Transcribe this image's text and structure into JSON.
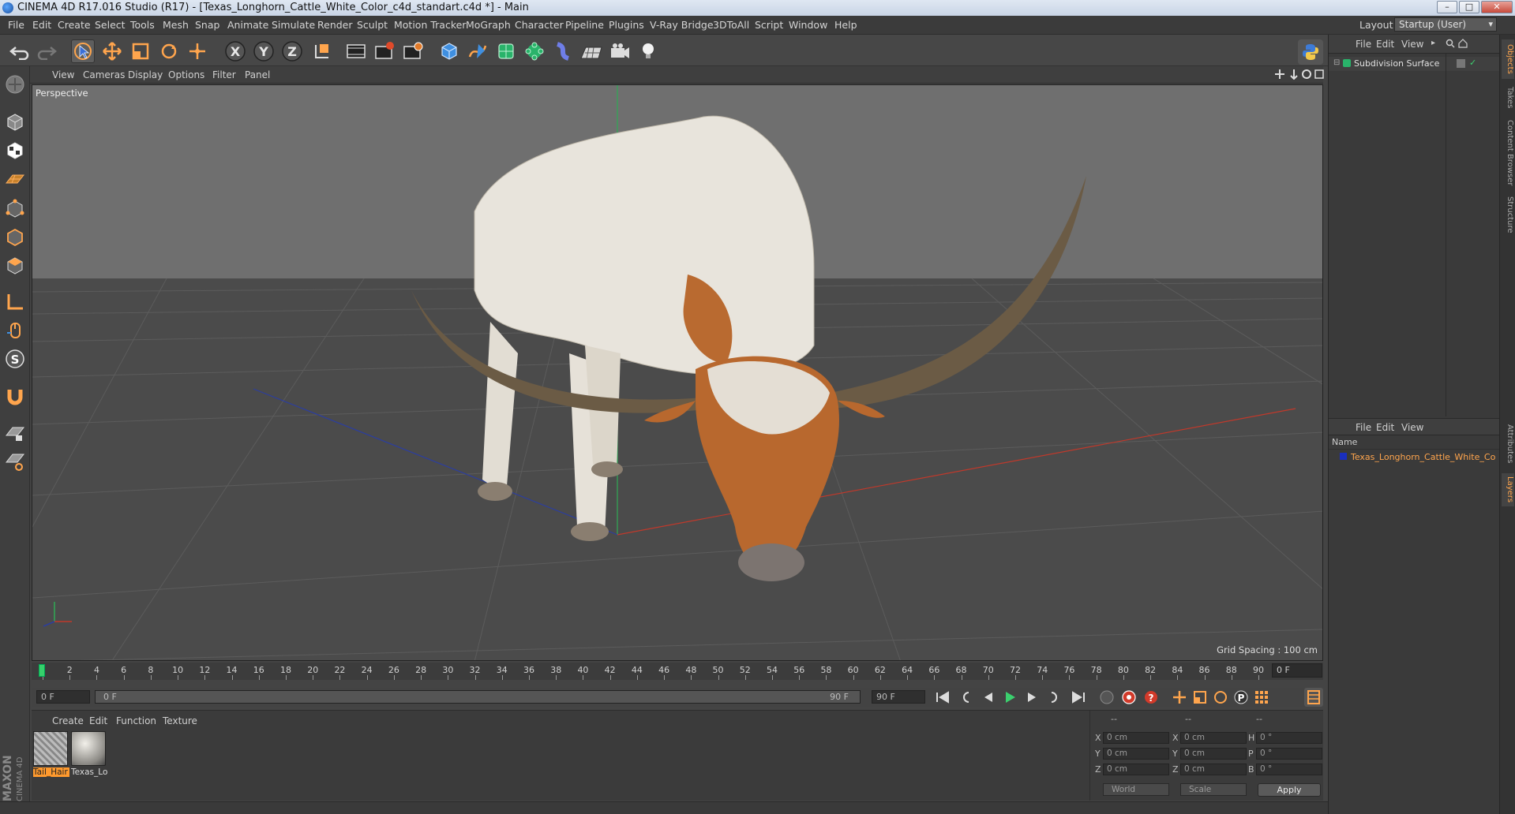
{
  "window": {
    "title": "CINEMA 4D R17.016 Studio (R17) - [Texas_Longhorn_Cattle_White_Color_c4d_standart.c4d *] - Main",
    "buttons": {
      "minimize": "–",
      "maximize": "□",
      "close": "✕"
    }
  },
  "menubar": {
    "items": [
      "File",
      "Edit",
      "Create",
      "Select",
      "Tools",
      "Mesh",
      "Snap",
      "Animate",
      "Simulate",
      "Render",
      "Sculpt",
      "Motion Tracker",
      "MoGraph",
      "Character",
      "Pipeline",
      "Plugins",
      "V-Ray Bridge",
      "3DToAll",
      "Script",
      "Window",
      "Help"
    ],
    "layout_label": "Layout:",
    "layout_value": "Startup (User)"
  },
  "viewport": {
    "menu": [
      "View",
      "Cameras",
      "Display",
      "Options",
      "Filter",
      "Panel"
    ],
    "camera_label": "Perspective",
    "grid_spacing": "Grid Spacing : 100 cm"
  },
  "timeline": {
    "ticks": [
      "0",
      "2",
      "4",
      "6",
      "8",
      "10",
      "12",
      "14",
      "16",
      "18",
      "20",
      "22",
      "24",
      "26",
      "28",
      "30",
      "32",
      "34",
      "36",
      "38",
      "40",
      "42",
      "44",
      "46",
      "48",
      "50",
      "52",
      "54",
      "56",
      "58",
      "60",
      "62",
      "64",
      "66",
      "68",
      "70",
      "72",
      "74",
      "76",
      "78",
      "80",
      "82",
      "84",
      "86",
      "88",
      "90"
    ],
    "current_frame": "0 F"
  },
  "transport": {
    "start_field": "0 F",
    "range_start": "0 F",
    "range_end": "90 F",
    "end_field": "90 F"
  },
  "material_panel": {
    "menu": [
      "Create",
      "Edit",
      "Function",
      "Texture"
    ],
    "materials": [
      {
        "label": "Tail_Hair",
        "selected": true
      },
      {
        "label": "Texas_Lo",
        "selected": false
      }
    ]
  },
  "coordinates": {
    "headers": [
      "--",
      "--",
      "--"
    ],
    "rows": [
      {
        "a_label": "X",
        "a_value": "0 cm",
        "b_label": "X",
        "b_value": "0 cm",
        "c_label": "H",
        "c_value": "0 °"
      },
      {
        "a_label": "Y",
        "a_value": "0 cm",
        "b_label": "Y",
        "b_value": "0 cm",
        "c_label": "P",
        "c_value": "0 °"
      },
      {
        "a_label": "Z",
        "a_value": "0 cm",
        "b_label": "Z",
        "b_value": "0 cm",
        "c_label": "B",
        "c_value": "0 °"
      }
    ],
    "space_dropdown": "World",
    "mode_dropdown": "Scale",
    "apply_label": "Apply"
  },
  "object_manager": {
    "menu": [
      "File",
      "Edit",
      "View"
    ],
    "objects": [
      {
        "name": "Subdivision Surface"
      }
    ]
  },
  "layer_manager": {
    "menu": [
      "File",
      "Edit",
      "View"
    ],
    "name_header": "Name",
    "layers": [
      {
        "name": "Texas_Longhorn_Cattle_White_Co"
      }
    ]
  },
  "side_tabs": [
    "Objects",
    "Takes",
    "Content Browser",
    "Structure",
    "Attributes",
    "Layers"
  ],
  "branding": {
    "maxon": "MAXON",
    "cinema": "CINEMA 4D"
  },
  "colors": {
    "accent": "#ffa54d",
    "playhead": "#36d06b",
    "axis_x": "#c0392b",
    "axis_y": "#27ae60",
    "axis_z": "#2c3e9e"
  }
}
